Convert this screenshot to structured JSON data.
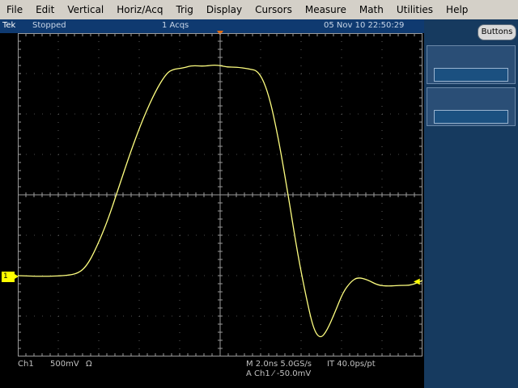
{
  "menu": [
    "File",
    "Edit",
    "Vertical",
    "Horiz/Acq",
    "Trig",
    "Display",
    "Cursors",
    "Measure",
    "Math",
    "Utilities",
    "Help"
  ],
  "status": {
    "brand": "Tek",
    "state": "Stopped",
    "acqs": "1 Acqs",
    "datetime": "05 Nov 10 22:50:29"
  },
  "right_panel": {
    "buttons_label": "Buttons"
  },
  "channel_marker": "1",
  "footer": {
    "channel": "Ch1",
    "volts_div": "500mV",
    "impedance": "Ω",
    "timebase": "M 2.0ns 5.0GS/s",
    "it": "IT 40.0ps/pt",
    "trigger": "A  Ch1  ⁄  -50.0mV"
  },
  "colors": {
    "trace": "#ffff80",
    "grid": "#9a9a9a",
    "status_bg": "#0f3a70",
    "panel_bg": "#163a5f",
    "marker": "#ffff00"
  }
}
